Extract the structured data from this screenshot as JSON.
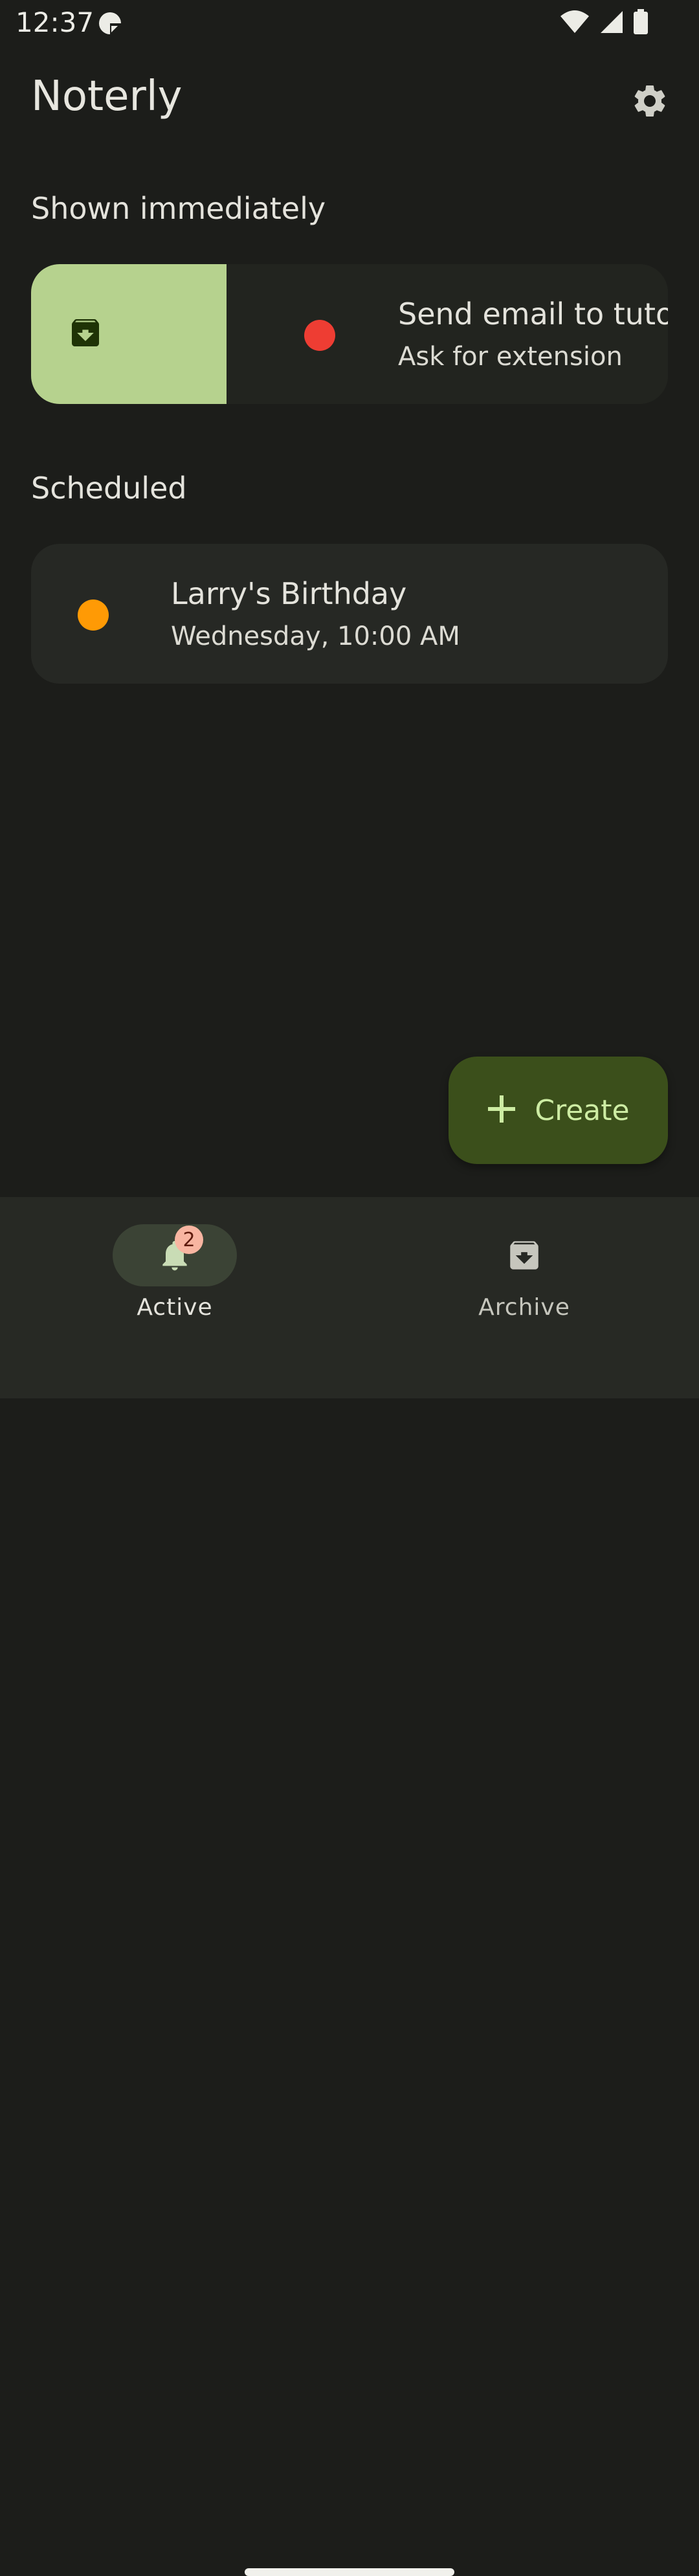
{
  "status_bar": {
    "time": "12:37"
  },
  "app": {
    "title": "Noterly"
  },
  "sections": {
    "immediate": "Shown immediately",
    "scheduled": "Scheduled"
  },
  "notes": [
    {
      "title": "Send email to tutor",
      "subtitle": "Ask for extension",
      "color": "#ee3d33",
      "icon": "archive-icon"
    },
    {
      "title": "Larry's Birthday",
      "subtitle": "Wednesday, 10:00 AM",
      "color": "#ff9a05"
    }
  ],
  "fab": {
    "label": "Create",
    "icon": "plus-icon"
  },
  "nav": {
    "items": [
      {
        "label": "Active",
        "icon": "bell-icon",
        "badge": "2",
        "selected": true
      },
      {
        "label": "Archive",
        "icon": "archive-icon",
        "selected": false
      }
    ]
  },
  "colors": {
    "background": "#1c1d1a",
    "card": "#262824",
    "archive_swipe": "#b6d28e",
    "fab": "#3b4f1b",
    "accent": "#cdeca3"
  }
}
